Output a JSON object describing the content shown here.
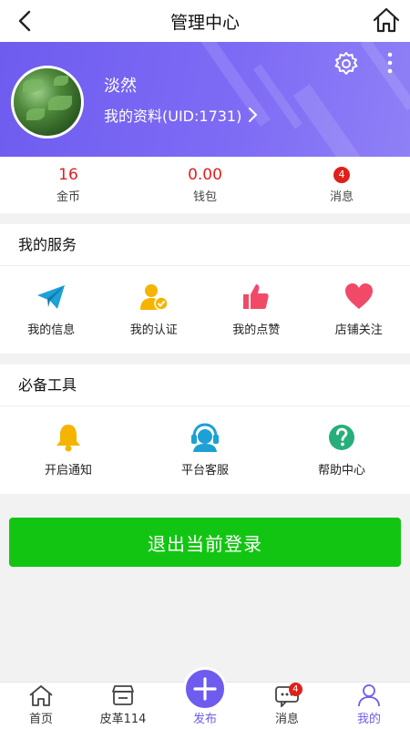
{
  "header": {
    "title": "管理中心"
  },
  "profile": {
    "name": "淡然",
    "profile_link": "我的资料(UID:1731)"
  },
  "stats": {
    "coins": {
      "value": "16",
      "label": "金币"
    },
    "wallet": {
      "value": "0.00",
      "label": "钱包"
    },
    "messages": {
      "badge": "4",
      "label": "消息"
    }
  },
  "services": {
    "title": "我的服务",
    "items": [
      {
        "label": "我的信息",
        "icon": "paper-plane-icon"
      },
      {
        "label": "我的认证",
        "icon": "verified-user-icon"
      },
      {
        "label": "我的点赞",
        "icon": "thumbs-up-icon"
      },
      {
        "label": "店铺关注",
        "icon": "heart-icon"
      }
    ]
  },
  "tools": {
    "title": "必备工具",
    "items": [
      {
        "label": "开启通知",
        "icon": "bell-icon"
      },
      {
        "label": "平台客服",
        "icon": "headset-icon"
      },
      {
        "label": "帮助中心",
        "icon": "question-icon"
      }
    ]
  },
  "logout_label": "退出当前登录",
  "tabbar": {
    "items": [
      {
        "label": "首页",
        "icon": "home-icon"
      },
      {
        "label": "皮革114",
        "icon": "store-icon"
      },
      {
        "label": "发布",
        "icon": "plus-icon"
      },
      {
        "label": "消息",
        "icon": "chat-icon",
        "badge": "4"
      },
      {
        "label": "我的",
        "icon": "user-icon",
        "active": true
      }
    ]
  },
  "colors": {
    "primary": "#6e5cf0",
    "logout": "#13c513",
    "badge": "#e0201b"
  }
}
